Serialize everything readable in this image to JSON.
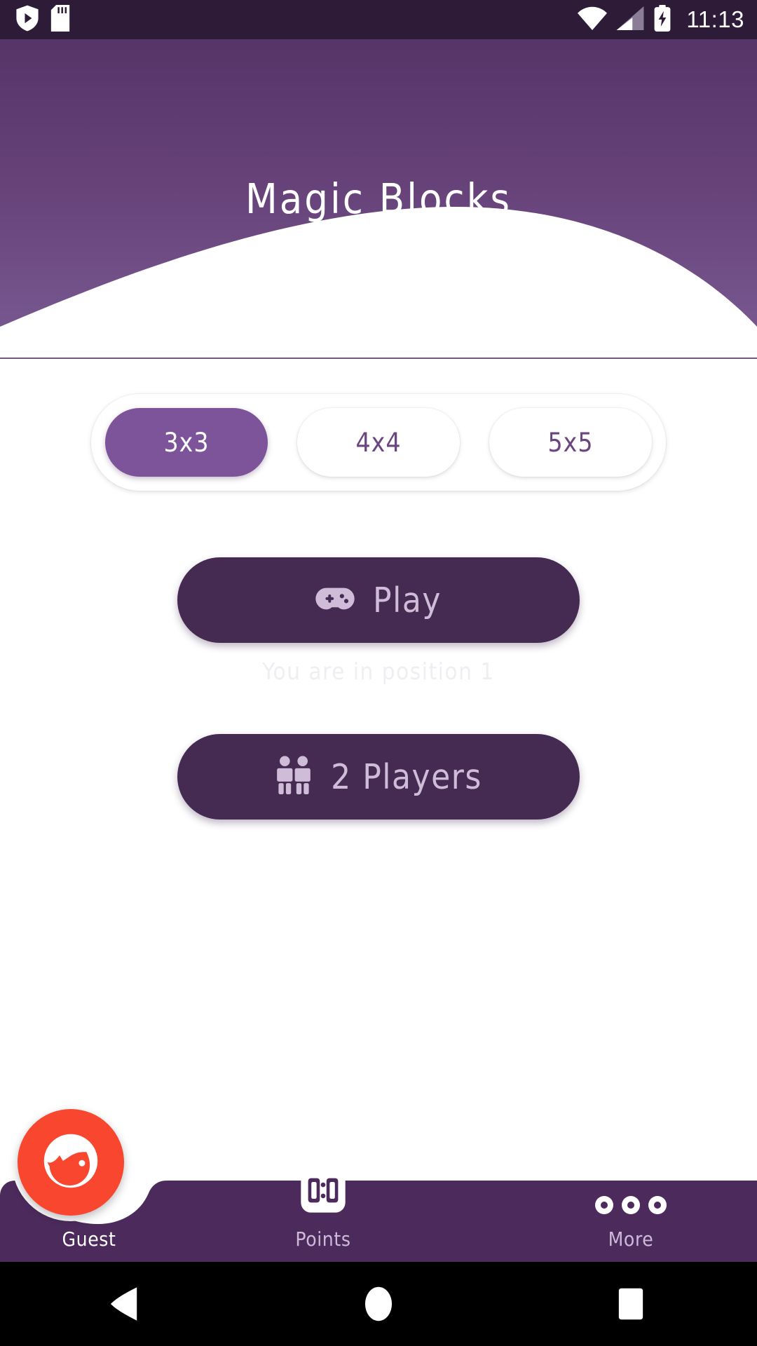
{
  "statusbar": {
    "time": "11:13",
    "icons": [
      "play-protect-icon",
      "sd-card-icon",
      "wifi-icon",
      "cell-signal-icon",
      "battery-charging-icon"
    ]
  },
  "header": {
    "title": "Magic Blocks",
    "gradient_top": "#563468",
    "gradient_bottom": "#7b5a93",
    "arc_color": "#ffffff",
    "rule_color": "#5c3a6f"
  },
  "board_sizes": {
    "options": [
      {
        "label": "3x3",
        "selected": true
      },
      {
        "label": "4x4",
        "selected": false
      },
      {
        "label": "5x5",
        "selected": false
      }
    ],
    "active_bg": "#7d5499",
    "active_text": "#ffffff",
    "inactive_text": "#6b4580"
  },
  "actions": {
    "play": {
      "label": "Play",
      "icon": "gamepad-icon",
      "bg": "#452b52",
      "text_color": "#cfbcd9"
    },
    "position_note": "You are in position 1",
    "two_players": {
      "label": "2 Players",
      "icon": "two-people-icon",
      "bg": "#452b52",
      "text_color": "#cfbcd9"
    }
  },
  "bottomnav": {
    "bg": "#4c2a5c",
    "items": [
      {
        "label": "Guest",
        "icon": "avatar-face-icon",
        "accent": "#f9462f"
      },
      {
        "label": "Points",
        "icon": "scoreboard-icon",
        "score": "0:0"
      },
      {
        "label": "More",
        "icon": "three-dots-icon"
      }
    ]
  },
  "androidnav": {
    "buttons": [
      {
        "name": "back",
        "icon": "back-triangle-icon"
      },
      {
        "name": "home",
        "icon": "home-circle-icon"
      },
      {
        "name": "recents",
        "icon": "recents-square-icon"
      }
    ]
  }
}
